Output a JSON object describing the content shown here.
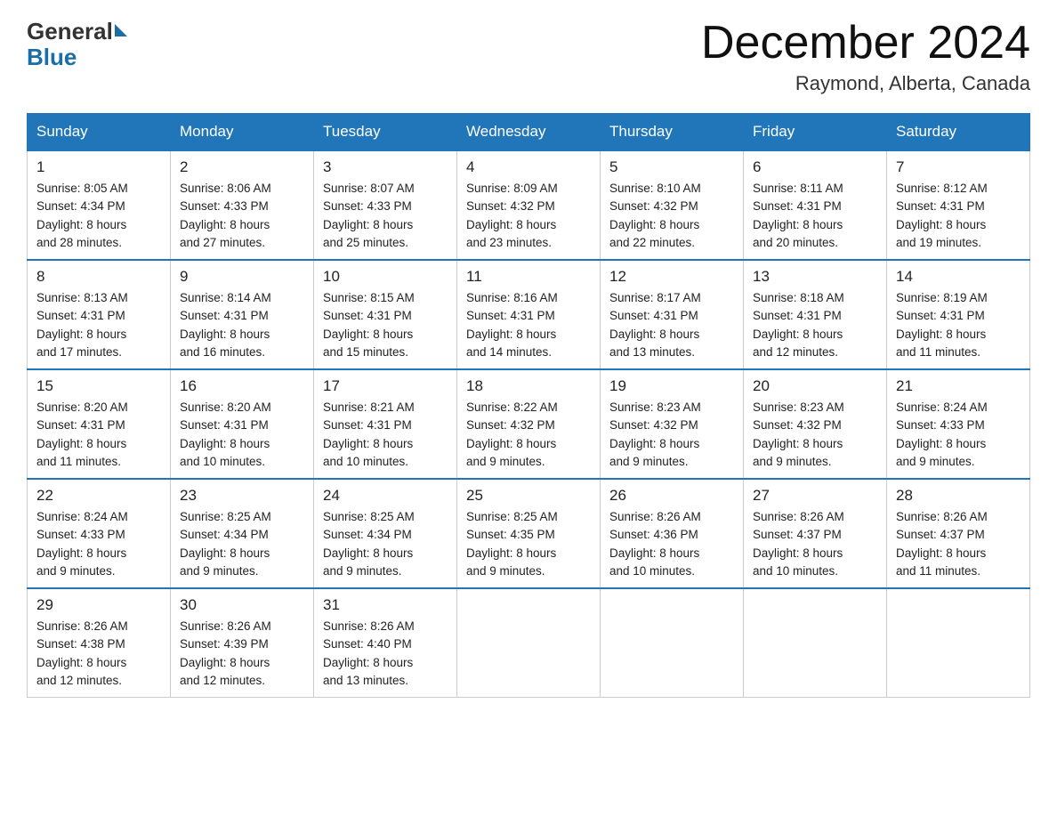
{
  "header": {
    "logo_general": "General",
    "logo_blue": "Blue",
    "month_title": "December 2024",
    "location": "Raymond, Alberta, Canada"
  },
  "days_of_week": [
    "Sunday",
    "Monday",
    "Tuesday",
    "Wednesday",
    "Thursday",
    "Friday",
    "Saturday"
  ],
  "weeks": [
    [
      {
        "day": "1",
        "sunrise": "8:05 AM",
        "sunset": "4:34 PM",
        "daylight": "8 hours and 28 minutes."
      },
      {
        "day": "2",
        "sunrise": "8:06 AM",
        "sunset": "4:33 PM",
        "daylight": "8 hours and 27 minutes."
      },
      {
        "day": "3",
        "sunrise": "8:07 AM",
        "sunset": "4:33 PM",
        "daylight": "8 hours and 25 minutes."
      },
      {
        "day": "4",
        "sunrise": "8:09 AM",
        "sunset": "4:32 PM",
        "daylight": "8 hours and 23 minutes."
      },
      {
        "day": "5",
        "sunrise": "8:10 AM",
        "sunset": "4:32 PM",
        "daylight": "8 hours and 22 minutes."
      },
      {
        "day": "6",
        "sunrise": "8:11 AM",
        "sunset": "4:31 PM",
        "daylight": "8 hours and 20 minutes."
      },
      {
        "day": "7",
        "sunrise": "8:12 AM",
        "sunset": "4:31 PM",
        "daylight": "8 hours and 19 minutes."
      }
    ],
    [
      {
        "day": "8",
        "sunrise": "8:13 AM",
        "sunset": "4:31 PM",
        "daylight": "8 hours and 17 minutes."
      },
      {
        "day": "9",
        "sunrise": "8:14 AM",
        "sunset": "4:31 PM",
        "daylight": "8 hours and 16 minutes."
      },
      {
        "day": "10",
        "sunrise": "8:15 AM",
        "sunset": "4:31 PM",
        "daylight": "8 hours and 15 minutes."
      },
      {
        "day": "11",
        "sunrise": "8:16 AM",
        "sunset": "4:31 PM",
        "daylight": "8 hours and 14 minutes."
      },
      {
        "day": "12",
        "sunrise": "8:17 AM",
        "sunset": "4:31 PM",
        "daylight": "8 hours and 13 minutes."
      },
      {
        "day": "13",
        "sunrise": "8:18 AM",
        "sunset": "4:31 PM",
        "daylight": "8 hours and 12 minutes."
      },
      {
        "day": "14",
        "sunrise": "8:19 AM",
        "sunset": "4:31 PM",
        "daylight": "8 hours and 11 minutes."
      }
    ],
    [
      {
        "day": "15",
        "sunrise": "8:20 AM",
        "sunset": "4:31 PM",
        "daylight": "8 hours and 11 minutes."
      },
      {
        "day": "16",
        "sunrise": "8:20 AM",
        "sunset": "4:31 PM",
        "daylight": "8 hours and 10 minutes."
      },
      {
        "day": "17",
        "sunrise": "8:21 AM",
        "sunset": "4:31 PM",
        "daylight": "8 hours and 10 minutes."
      },
      {
        "day": "18",
        "sunrise": "8:22 AM",
        "sunset": "4:32 PM",
        "daylight": "8 hours and 9 minutes."
      },
      {
        "day": "19",
        "sunrise": "8:23 AM",
        "sunset": "4:32 PM",
        "daylight": "8 hours and 9 minutes."
      },
      {
        "day": "20",
        "sunrise": "8:23 AM",
        "sunset": "4:32 PM",
        "daylight": "8 hours and 9 minutes."
      },
      {
        "day": "21",
        "sunrise": "8:24 AM",
        "sunset": "4:33 PM",
        "daylight": "8 hours and 9 minutes."
      }
    ],
    [
      {
        "day": "22",
        "sunrise": "8:24 AM",
        "sunset": "4:33 PM",
        "daylight": "8 hours and 9 minutes."
      },
      {
        "day": "23",
        "sunrise": "8:25 AM",
        "sunset": "4:34 PM",
        "daylight": "8 hours and 9 minutes."
      },
      {
        "day": "24",
        "sunrise": "8:25 AM",
        "sunset": "4:34 PM",
        "daylight": "8 hours and 9 minutes."
      },
      {
        "day": "25",
        "sunrise": "8:25 AM",
        "sunset": "4:35 PM",
        "daylight": "8 hours and 9 minutes."
      },
      {
        "day": "26",
        "sunrise": "8:26 AM",
        "sunset": "4:36 PM",
        "daylight": "8 hours and 10 minutes."
      },
      {
        "day": "27",
        "sunrise": "8:26 AM",
        "sunset": "4:37 PM",
        "daylight": "8 hours and 10 minutes."
      },
      {
        "day": "28",
        "sunrise": "8:26 AM",
        "sunset": "4:37 PM",
        "daylight": "8 hours and 11 minutes."
      }
    ],
    [
      {
        "day": "29",
        "sunrise": "8:26 AM",
        "sunset": "4:38 PM",
        "daylight": "8 hours and 12 minutes."
      },
      {
        "day": "30",
        "sunrise": "8:26 AM",
        "sunset": "4:39 PM",
        "daylight": "8 hours and 12 minutes."
      },
      {
        "day": "31",
        "sunrise": "8:26 AM",
        "sunset": "4:40 PM",
        "daylight": "8 hours and 13 minutes."
      },
      null,
      null,
      null,
      null
    ]
  ],
  "labels": {
    "sunrise_prefix": "Sunrise: ",
    "sunset_prefix": "Sunset: ",
    "daylight_prefix": "Daylight: "
  }
}
